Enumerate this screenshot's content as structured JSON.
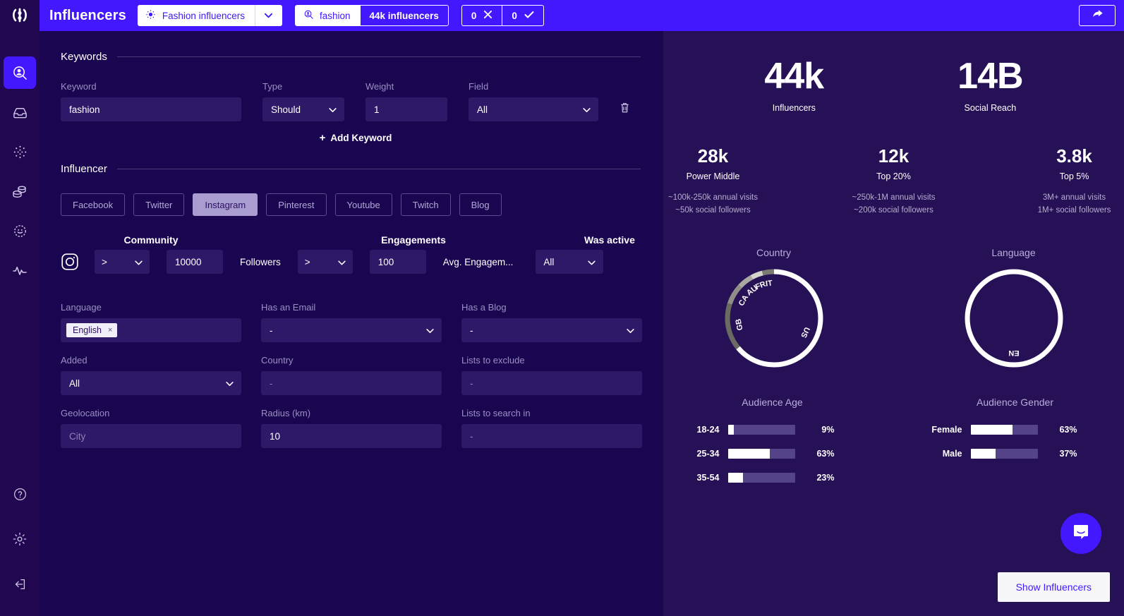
{
  "header": {
    "app_title": "Influencers",
    "saved_search": "Fashion influencers",
    "search_query": "fashion",
    "result_count": "44k influencers",
    "reject_count": "0",
    "accept_count": "0",
    "share_icon": "share-arrow-icon"
  },
  "rail": {
    "logo": "brand-logo-icon",
    "items": [
      {
        "name": "influencer-search",
        "icon": "person-search-icon",
        "active": true
      },
      {
        "name": "inbox",
        "icon": "inbox-icon",
        "active": false
      },
      {
        "name": "discover",
        "icon": "sparkle-dots-icon",
        "active": false
      },
      {
        "name": "budget",
        "icon": "coins-stack-icon",
        "active": false
      },
      {
        "name": "audience",
        "icon": "audience-network-icon",
        "active": false
      },
      {
        "name": "analytics",
        "icon": "activity-pulse-icon",
        "active": false
      }
    ],
    "bottom": [
      {
        "name": "help",
        "icon": "question-circle-icon"
      },
      {
        "name": "settings",
        "icon": "gear-icon"
      },
      {
        "name": "logout",
        "icon": "logout-icon"
      }
    ]
  },
  "keywords": {
    "section_title": "Keywords",
    "labels": {
      "keyword": "Keyword",
      "type": "Type",
      "weight": "Weight",
      "field": "Field"
    },
    "row": {
      "keyword": "fashion",
      "type": "Should",
      "weight": "1",
      "field": "All",
      "delete_icon": "trash-icon"
    },
    "add_label": "Add Keyword",
    "add_plus": "+"
  },
  "influencer": {
    "section_title": "Influencer",
    "platforms": [
      {
        "label": "Facebook",
        "selected": false
      },
      {
        "label": "Twitter",
        "selected": false
      },
      {
        "label": "Instagram",
        "selected": true
      },
      {
        "label": "Pinterest",
        "selected": false
      },
      {
        "label": "Youtube",
        "selected": false
      },
      {
        "label": "Twitch",
        "selected": false
      },
      {
        "label": "Blog",
        "selected": false
      }
    ],
    "metrics": {
      "community_header": "Community",
      "engagements_header": "Engagements",
      "was_active_header": "Was active",
      "platform_icon": "instagram-icon",
      "community_operator": ">",
      "community_value": "10000",
      "community_unit": "Followers",
      "engagement_operator": ">",
      "engagement_value": "100",
      "engagement_unit": "Avg. Engagem...",
      "was_active_value": "All"
    },
    "fields": {
      "language_label": "Language",
      "language_tag": "English",
      "language_tag_remove": "×",
      "has_email_label": "Has an Email",
      "has_email_value": "-",
      "has_blog_label": "Has a Blog",
      "has_blog_value": "-",
      "added_label": "Added",
      "added_value": "All",
      "country_label": "Country",
      "country_value": "-",
      "lists_exclude_label": "Lists to exclude",
      "lists_exclude_value": "-",
      "geolocation_label": "Geolocation",
      "geolocation_placeholder": "City",
      "radius_label": "Radius (km)",
      "radius_value": "10",
      "lists_search_label": "Lists to search in",
      "lists_search_value": "-"
    }
  },
  "summary": {
    "top": [
      {
        "value": "44k",
        "caption": "Influencers"
      },
      {
        "value": "14B",
        "caption": "Social Reach"
      }
    ],
    "tiers": [
      {
        "value": "28k",
        "caption": "Power Middle",
        "line1": "~100k-250k annual visits",
        "line2": "~50k social followers"
      },
      {
        "value": "12k",
        "caption": "Top 20%",
        "line1": "~250k-1M annual visits",
        "line2": "~200k social followers"
      },
      {
        "value": "3.8k",
        "caption": "Top 5%",
        "line1": "3M+ annual visits",
        "line2": "1M+ social followers"
      }
    ],
    "show_influencers": "Show Influencers",
    "chat_icon": "intercom-chat-icon"
  },
  "chart_data": [
    {
      "type": "pie",
      "title": "Country",
      "labels": [
        "US",
        "GB",
        "CA",
        "AU",
        "FR",
        "IT"
      ],
      "values": [
        64,
        16,
        7,
        5,
        4,
        4
      ],
      "colors": [
        "#ffffff",
        "#6b6b63",
        "#8f8f87",
        "#a8a8a0",
        "#d4d4cd",
        "#7a7a72"
      ],
      "legend": "on-arc",
      "donut": true
    },
    {
      "type": "pie",
      "title": "Language",
      "labels": [
        "EN"
      ],
      "values": [
        100
      ],
      "colors": [
        "#ffffff"
      ],
      "legend": "on-arc",
      "donut": true
    },
    {
      "type": "bar",
      "title": "Audience Age",
      "orientation": "horizontal",
      "categories": [
        "18-24",
        "25-34",
        "35-54"
      ],
      "values": [
        9,
        63,
        23
      ],
      "value_labels": [
        "9%",
        "63%",
        "23%"
      ],
      "ylim": [
        0,
        100
      ],
      "fill_color": "#ffffff",
      "track_color": "#554387"
    },
    {
      "type": "bar",
      "title": "Audience Gender",
      "orientation": "horizontal",
      "categories": [
        "Female",
        "Male"
      ],
      "values": [
        63,
        37
      ],
      "value_labels": [
        "63%",
        "37%"
      ],
      "ylim": [
        0,
        100
      ],
      "fill_color": "#ffffff",
      "track_color": "#554387"
    }
  ],
  "theme": {
    "brand": "#4318ff",
    "left_bg": "#1a0650",
    "right_bg": "#261056",
    "rail_bg": "#200750",
    "input_bg": "#2e1868"
  }
}
